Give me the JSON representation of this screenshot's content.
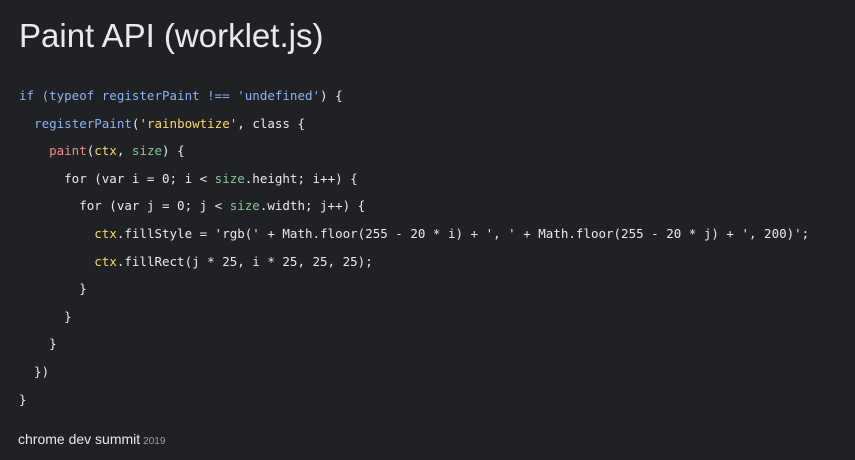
{
  "slide": {
    "title": "Paint API (worklet.js)"
  },
  "colors": {
    "background": "#202124",
    "text": "#e8eaed",
    "keyword": "#8ab4f8",
    "string": "#fdd663",
    "method": "#f28b82",
    "param_ctx": "#fdd663",
    "param_size": "#81c995"
  },
  "code": {
    "lines": [
      [
        {
          "t": "if (typeof registerPaint !== ",
          "c": "kw"
        },
        {
          "t": "'undefined'",
          "c": "kw"
        },
        {
          "t": ") {",
          "c": "plain"
        }
      ],
      [
        {
          "t": "  ",
          "c": "plain"
        },
        {
          "t": "registerPaint",
          "c": "fn"
        },
        {
          "t": "(",
          "c": "plain"
        },
        {
          "t": "'rainbowtize'",
          "c": "str"
        },
        {
          "t": ", class {",
          "c": "plain"
        }
      ],
      [
        {
          "t": "    ",
          "c": "plain"
        },
        {
          "t": "paint",
          "c": "method"
        },
        {
          "t": "(",
          "c": "plain"
        },
        {
          "t": "ctx",
          "c": "param"
        },
        {
          "t": ", ",
          "c": "plain"
        },
        {
          "t": "size",
          "c": "param2"
        },
        {
          "t": ") {",
          "c": "plain"
        }
      ],
      [
        {
          "t": "      for (var i = 0; i < ",
          "c": "plain"
        },
        {
          "t": "size",
          "c": "param2"
        },
        {
          "t": ".height; i++) {",
          "c": "plain"
        }
      ],
      [
        {
          "t": "        for (var j = 0; j < ",
          "c": "plain"
        },
        {
          "t": "size",
          "c": "param2"
        },
        {
          "t": ".width; j++) {",
          "c": "plain"
        }
      ],
      [
        {
          "t": "          ",
          "c": "plain"
        },
        {
          "t": "ctx",
          "c": "param"
        },
        {
          "t": ".fillStyle = 'rgb(' + Math.floor(255 - 20 * i) + ', ' + Math.floor(255 - 20 * j) + ', 200)';",
          "c": "plain"
        }
      ],
      [
        {
          "t": "          ",
          "c": "plain"
        },
        {
          "t": "ctx",
          "c": "param"
        },
        {
          "t": ".fillRect(j * 25, i * 25, 25, 25);",
          "c": "plain"
        }
      ],
      [
        {
          "t": "        }",
          "c": "plain"
        }
      ],
      [
        {
          "t": "      }",
          "c": "plain"
        }
      ],
      [
        {
          "t": "    }",
          "c": "plain"
        }
      ],
      [
        {
          "t": "  })",
          "c": "plain"
        }
      ],
      [
        {
          "t": "}",
          "c": "plain"
        }
      ]
    ]
  },
  "footer": {
    "brand": "chrome dev summit",
    "year": "2019"
  }
}
